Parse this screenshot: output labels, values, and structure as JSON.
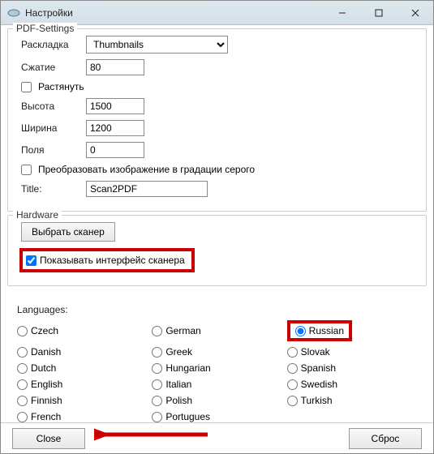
{
  "window": {
    "title": "Настройки"
  },
  "pdf": {
    "legend": "PDF-Settings",
    "layout_label": "Раскладка",
    "layout_value": "Thumbnails",
    "compress_label": "Сжатие",
    "compress_value": "80",
    "stretch_label": "Растянуть",
    "height_label": "Высота",
    "height_value": "1500",
    "width_label": "Ширина",
    "width_value": "1200",
    "margins_label": "Поля",
    "margins_value": "0",
    "grayscale_label": "Преобразовать изображение в градации серого",
    "title_label": "Title:",
    "title_value": "Scan2PDF"
  },
  "hardware": {
    "legend": "Hardware",
    "select_scanner_btn": "Выбрать сканер",
    "show_interface_label": "Показывать интерфейс сканера"
  },
  "languages": {
    "title": "Languages:",
    "items": [
      {
        "label": "Czech",
        "selected": false
      },
      {
        "label": "German",
        "selected": false
      },
      {
        "label": "Russian",
        "selected": true
      },
      {
        "label": "Danish",
        "selected": false
      },
      {
        "label": "Greek",
        "selected": false
      },
      {
        "label": "Slovak",
        "selected": false
      },
      {
        "label": "Dutch",
        "selected": false
      },
      {
        "label": "Hungarian",
        "selected": false
      },
      {
        "label": "Spanish",
        "selected": false
      },
      {
        "label": "English",
        "selected": false
      },
      {
        "label": "Italian",
        "selected": false
      },
      {
        "label": "Swedish",
        "selected": false
      },
      {
        "label": "Finnish",
        "selected": false
      },
      {
        "label": "Polish",
        "selected": false
      },
      {
        "label": "Turkish",
        "selected": false
      },
      {
        "label": "French",
        "selected": false
      },
      {
        "label": "Portugues",
        "selected": false
      }
    ]
  },
  "footer": {
    "close": "Close",
    "reset": "Сброс"
  }
}
